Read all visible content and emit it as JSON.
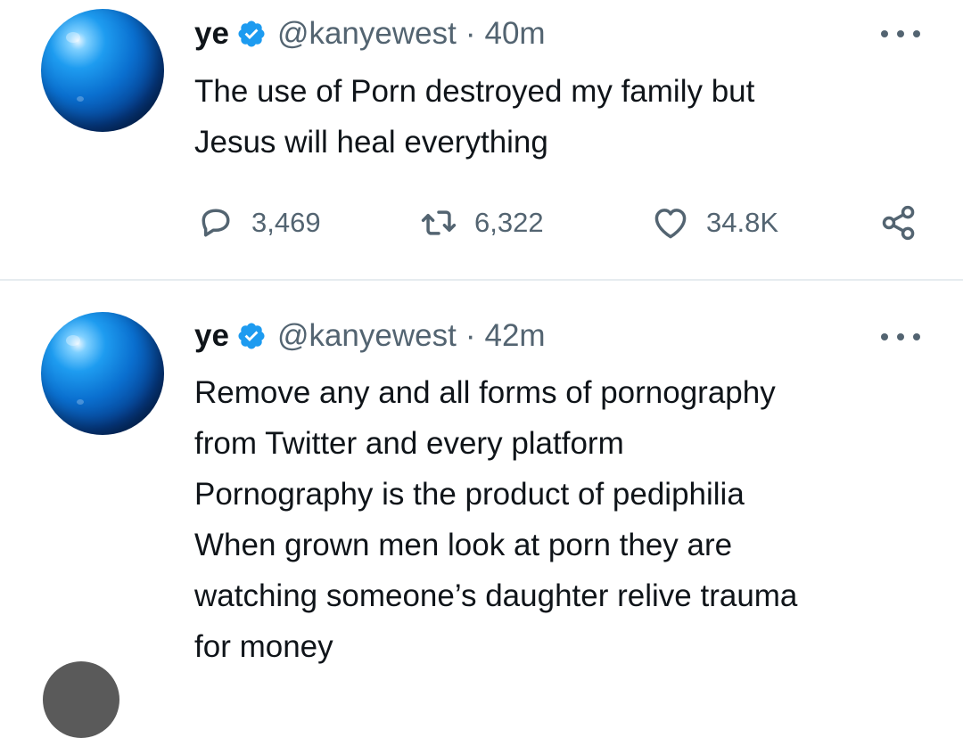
{
  "tweets": [
    {
      "display_name": "ye",
      "handle": "@kanyewest",
      "separator": "·",
      "time": "40m",
      "text_lines": [
        "The use of Porn destroyed my family but",
        "Jesus will heal everything"
      ],
      "stats": {
        "replies": "3,469",
        "retweets": "6,322",
        "likes": "34.8K"
      }
    },
    {
      "display_name": "ye",
      "handle": "@kanyewest",
      "separator": "·",
      "time": "42m",
      "text_lines": [
        "Remove any and all forms of pornography",
        "from Twitter and every platform",
        "Pornography is the product of pediphilia",
        "When grown men look at porn they are",
        "watching someone’s daughter relive trauma",
        "for money"
      ]
    }
  ],
  "icons": {
    "verified": "verified-badge-icon",
    "more": "more-horizontal-icon",
    "reply": "reply-icon",
    "retweet": "retweet-icon",
    "like": "heart-icon",
    "share": "share-icon"
  },
  "colors": {
    "text": "#0f1419",
    "secondary": "#536471",
    "verified": "#1d9bf0",
    "divider": "#e6ecf0"
  }
}
